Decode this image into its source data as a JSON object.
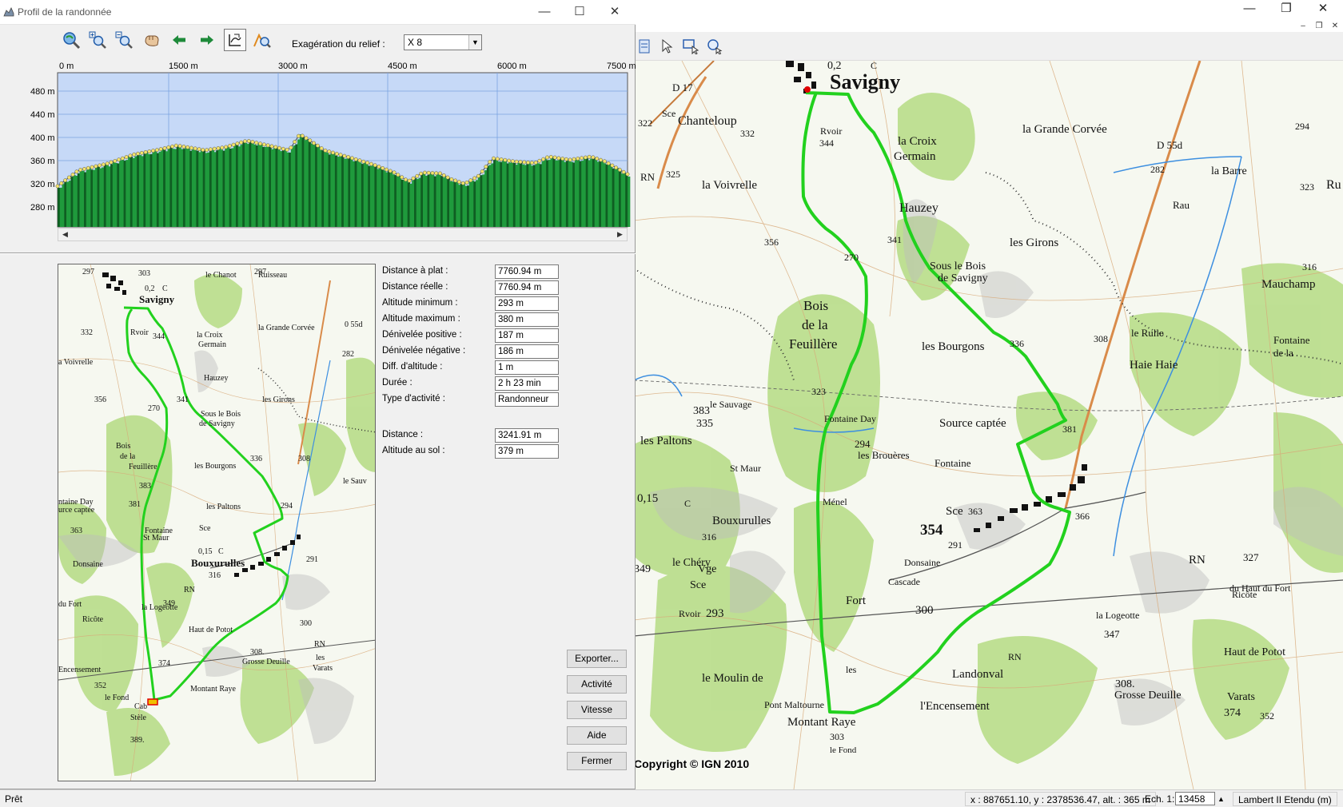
{
  "dialog": {
    "title": "Profil de la randonnée",
    "relief_label": "Exagération du relief :",
    "relief_value": "X 8",
    "profile": {
      "x_ticks": [
        "0 m",
        "1500 m",
        "3000 m",
        "4500 m",
        "6000 m",
        "7500 m"
      ],
      "y_ticks": [
        "480 m",
        "440 m",
        "400 m",
        "360 m",
        "320 m",
        "280 m"
      ]
    },
    "stats": [
      {
        "label": "Distance à plat :",
        "value": "7760.94 m"
      },
      {
        "label": "Distance réelle :",
        "value": "7760.94 m"
      },
      {
        "label": "Altitude minimum :",
        "value": "293 m"
      },
      {
        "label": "Altitude maximum :",
        "value": "380 m"
      },
      {
        "label": "Dénivelée positive :",
        "value": "187 m"
      },
      {
        "label": "Dénivelée négative :",
        "value": "186 m"
      },
      {
        "label": "Diff. d'altitude :",
        "value": "1 m"
      },
      {
        "label": "Durée :",
        "value": "2 h 23 min"
      },
      {
        "label": "Type d'activité :",
        "value": "Randonneur"
      }
    ],
    "cursor_stats": [
      {
        "label": "Distance :",
        "value": "3241.91 m"
      },
      {
        "label": "Altitude au sol :",
        "value": "379 m"
      }
    ],
    "buttons": {
      "export": "Exporter...",
      "activity": "Activité",
      "speed": "Vitesse",
      "help": "Aide",
      "close": "Fermer"
    }
  },
  "map": {
    "copyright": "Copyright © IGN 2010",
    "labels": [
      "Savigny",
      "0,2",
      "C",
      "D 17",
      "Sce",
      "Chanteloup",
      "322",
      "332",
      "344",
      "Rvoir",
      "la Croix",
      "Germain",
      "la Grande Corvée",
      "D 55d",
      "294",
      "RN",
      "325",
      "la Voivrelle",
      "282",
      "la Barre",
      "323",
      "Ru",
      "Hauzey",
      "Rau",
      "341",
      "les Girons",
      "356",
      "270",
      "Sous le Bois",
      "de Savigny",
      "le Rulle",
      "316",
      "Mauchamp",
      "Bois",
      "de la",
      "Feuillère",
      "336",
      "308",
      "les Bourgons",
      "Fontaine",
      "de la",
      "Haie Haie",
      "323",
      "le Sauvage",
      "383",
      "335",
      "Fontaine Day",
      "Source captée",
      "381",
      "les Paltons",
      "294",
      "les Brouères",
      "Fontaine",
      "St Maur",
      "Sce",
      "363",
      "0,15",
      "C",
      "Ménel",
      "354",
      "366",
      "Bouxurulles",
      "291",
      "Donsaine",
      "316",
      "RN",
      "327",
      "le Chéry",
      "Vge",
      "Sce",
      "Cascade",
      "du Haut du Fort",
      "349",
      "293",
      "Fort",
      "Ricôte",
      "la Logeotte",
      "Rvoir",
      "300",
      "347",
      "Haut de Potot",
      "RN",
      "Landonval",
      "308.",
      "Grosse Deuille",
      "les",
      "Varats",
      "374",
      "le Moulin de",
      "Pont Maltourne",
      "l'Encensement",
      "352",
      "Montant Raye",
      "303",
      "le Fond",
      "Cab",
      "Stèle"
    ],
    "mini_labels": [
      "297",
      "303",
      "0,2",
      "C",
      "Savigny",
      "le Chanot",
      "297",
      "Ruisseau",
      "332",
      "344",
      "Rvoir",
      "la Grande Corvée",
      "la Croix",
      "Germain",
      "0 55d",
      "282",
      "a Voivrelle",
      "Hauzey",
      "356",
      "270",
      "341",
      "les Girons",
      "Sous le Bois",
      "de Savigny",
      "Bois",
      "de la",
      "Feuillère",
      "336",
      "308",
      "les Bourgons",
      "383",
      "le Sauv",
      "381",
      "les Paltons",
      "294",
      "Sce",
      "ntaine Day",
      "urce captée",
      "363",
      "Fontaine",
      "St Maur",
      "0,15",
      "C",
      "Donsaine",
      "Bouxurulles",
      "291",
      "316",
      "RN",
      "Ricôte",
      "la Logeotte",
      "349",
      "Haut de Potot",
      "300",
      "RN",
      "du Fort",
      "374",
      "308.",
      "Grosse Deuille",
      "Encensement",
      "352",
      "les",
      "Varats",
      "le Fond",
      "Montant Raye",
      "Cab",
      "Stèle",
      "389."
    ]
  },
  "status": {
    "ready": "Prêt",
    "coords": "x : 887651.10, y : 2378536.47, alt. : 365 m",
    "scale_label": "Ech. 1:",
    "scale_value": "13458",
    "projection": "Lambert II Etendu (m)"
  },
  "colors": {
    "track": "#22d11e",
    "profile_sky": "#c6d9f7",
    "profile_ground": "#1f9a3c",
    "profile_dots": "#f3e36a"
  }
}
